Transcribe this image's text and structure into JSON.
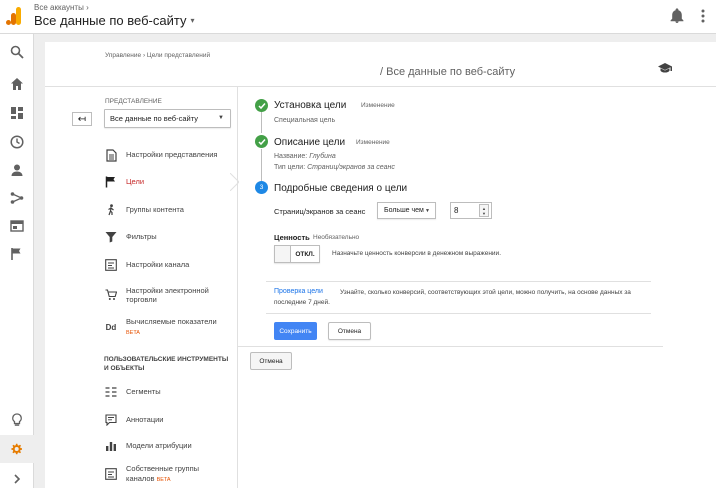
{
  "header": {
    "all_accounts": "Все аккаунты",
    "all_accounts_chevron": "›",
    "view_title": "Все данные по веб-сайту",
    "view_caret": "▾"
  },
  "breadcrumb": "Управление › Цели представлений",
  "page_view_title": "/ Все данные по веб-сайту",
  "nav": {
    "section_label": "ПРЕДСТАВЛЕНИЕ",
    "back_arrow": "↤",
    "view_select": "Все данные по веб-сайту",
    "items": [
      {
        "label": "Настройки представления",
        "icon": "file-icon"
      },
      {
        "label": "Цели",
        "icon": "flag-icon",
        "active": true
      },
      {
        "label": "Группы контента",
        "icon": "person-walk-icon"
      },
      {
        "label": "Фильтры",
        "icon": "filter-icon"
      },
      {
        "label": "Настройки канала",
        "icon": "channel-icon"
      },
      {
        "label": "Настройки электронной торговли",
        "icon": "cart-icon"
      },
      {
        "label": "Вычисляемые показатели",
        "icon": "dd-icon",
        "icon_text": "Dd",
        "beta": "BETA"
      }
    ],
    "section2_label": "ПОЛЬЗОВАТЕЛЬСКИЕ ИНСТРУМЕНТЫ И ОБЪЕКТЫ",
    "items2": [
      {
        "label": "Сегменты",
        "icon": "segments-icon"
      },
      {
        "label": "Аннотации",
        "icon": "annotation-icon"
      },
      {
        "label": "Модели атрибуции",
        "icon": "bar-chart-icon"
      },
      {
        "label": "Собственные группы каналов",
        "icon": "channel-groups-icon",
        "beta": "BETA"
      }
    ]
  },
  "goal": {
    "step1": {
      "title": "Установка цели",
      "edit": "Изменение",
      "sub": "Специальная цель"
    },
    "step2": {
      "title": "Описание цели",
      "edit": "Изменение",
      "name_label": "Название:",
      "name_value": "Глубина",
      "type_label": "Тип цели:",
      "type_value": "Страниц/экранов за сеанс"
    },
    "step3": {
      "number": "3",
      "title": "Подробные сведения о цели"
    },
    "pages_label": "Страниц/экранов за сеанс",
    "comparison": "Больше чем",
    "pages_value": "8",
    "value_label": "Ценность",
    "value_optional": "Необязательно",
    "toggle_state": "ОТКЛ.",
    "toggle_hint": "Назначьте ценность конверсии в денежном выражении.",
    "verify_link": "Проверка цели",
    "verify_text": "Узнайте, сколько конверсий, соответствующих этой цели, можно получить, на основе данных за последние 7 дней.",
    "save_label": "Сохранить",
    "cancel_label": "Отмена",
    "cancel2_label": "Отмена"
  },
  "colors": {
    "accent": "#4285f4",
    "step_done": "#43a047",
    "step_current": "#1e88e5",
    "active_nav": "#c62828",
    "settings_icon": "#e67c00",
    "beta": "#e65100"
  }
}
